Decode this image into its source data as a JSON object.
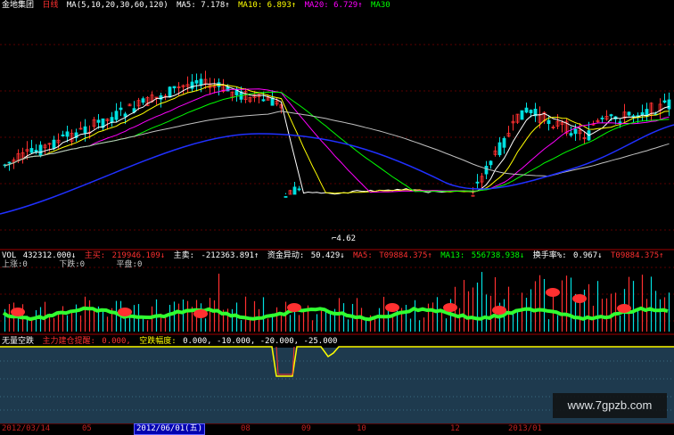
{
  "header": {
    "stock_name": "金地集团",
    "period": "日线",
    "ma_params": "MA(5,10,20,30,60,120)",
    "ma5_label": "MA5:",
    "ma5_value": "7.178↑",
    "ma10_label": "MA10:",
    "ma10_value": "6.893↑",
    "ma20_label": "MA20:",
    "ma20_value": "6.729↑",
    "ma30_label": "MA30"
  },
  "price_marker": "4.62",
  "volume_panel": {
    "vol_label": "VOL",
    "vol_value": "432312.000↓",
    "buy_label": "主买:",
    "buy_value": "219946.109↓",
    "sell_label": "主卖:",
    "sell_value": "-212363.891↑",
    "flow_label": "资金异动:",
    "flow_value": "50.429↓",
    "ma5_label": "MA5:",
    "ma5_value": "T09884.375↑",
    "ma13_label": "MA13:",
    "ma13_value": "556738.938↓",
    "turnover_label": "换手率%:",
    "turnover_value": "0.967↓",
    "tail_value": "T09884.375↑",
    "up_label": "上涨:0",
    "down_label": "下跌:0",
    "flat_label": "平盘:0"
  },
  "indicator_panel": {
    "name": "无量空跌",
    "alert_label": "主力建仓提醒:",
    "alert_value": "0.000,",
    "drop_label": "空跌幅度:",
    "drop_values": "0.000, -10.000, -20.000, -25.000"
  },
  "date_axis": {
    "d1": "2012/03/14",
    "d2": "05",
    "d3": "2012/06/01(五)",
    "d4": "08",
    "d5": "09",
    "d6": "10",
    "d7": "12",
    "d8": "2013/01"
  },
  "watermark": "www.7gpzb.com",
  "colors": {
    "up": "#ff3030",
    "down": "#00e0e0",
    "ma5": "#ffffff",
    "ma10": "#ffff00",
    "ma20": "#ff00ff",
    "ma30": "#00ff00",
    "ma60": "#c0c0c0",
    "ma120": "#2030ff",
    "indicator_line": "#ffff00",
    "indicator_bg": "#1e3a4e"
  }
}
